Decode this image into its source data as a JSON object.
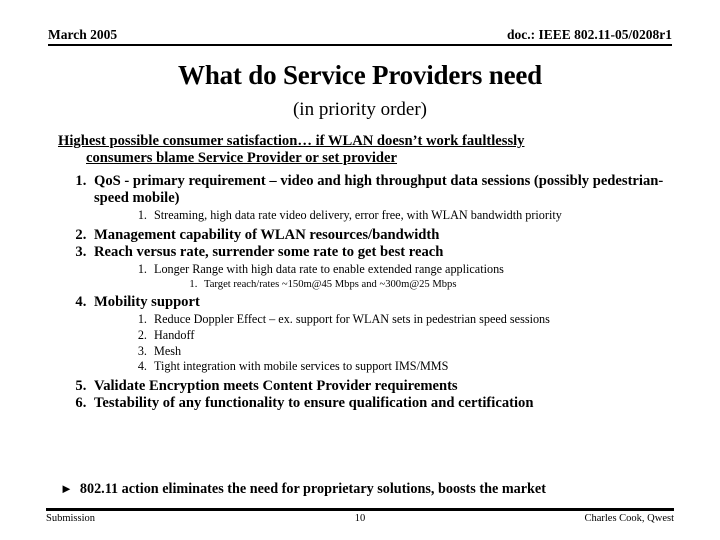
{
  "header": {
    "date": "March 2005",
    "doc_id": "doc.: IEEE 802.11-05/0208r1"
  },
  "title": "What do Service Providers need",
  "subtitle": "(in priority order)",
  "lead": {
    "line1": "Highest possible consumer satisfaction… if WLAN doesn’t work faultlessly",
    "line2": "consumers blame Service Provider or set provider"
  },
  "items": [
    {
      "text": "QoS - primary requirement – video and high throughput data sessions (possibly pedestrian-speed mobile)",
      "sub": [
        {
          "text": "Streaming, high data rate video delivery, error free, with WLAN bandwidth priority"
        }
      ]
    },
    {
      "text": "Management capability of WLAN resources/bandwidth",
      "sub": []
    },
    {
      "text": "Reach versus rate, surrender some rate to get best reach",
      "sub": [
        {
          "text": "Longer Range with high data rate to enable extended range applications",
          "sub": [
            {
              "text": "Target reach/rates ~150m@45 Mbps and ~300m@25 Mbps"
            }
          ]
        }
      ]
    },
    {
      "text": "Mobility support",
      "sub": [
        {
          "text": "Reduce Doppler Effect – ex. support for WLAN sets in pedestrian speed sessions"
        },
        {
          "text": "Handoff"
        },
        {
          "text": "Mesh"
        },
        {
          "text": "Tight integration with mobile services to support IMS/MMS"
        }
      ]
    },
    {
      "text": "Validate Encryption meets Content Provider requirements",
      "sub": []
    },
    {
      "text": "Testability of any functionality to ensure qualification and certification",
      "sub": []
    }
  ],
  "conclusion": {
    "bullet": "►",
    "text": "802.11 action eliminates the need for proprietary solutions, boosts the market"
  },
  "footer": {
    "left": "Submission",
    "page": "10",
    "right": "Charles Cook, Qwest"
  }
}
